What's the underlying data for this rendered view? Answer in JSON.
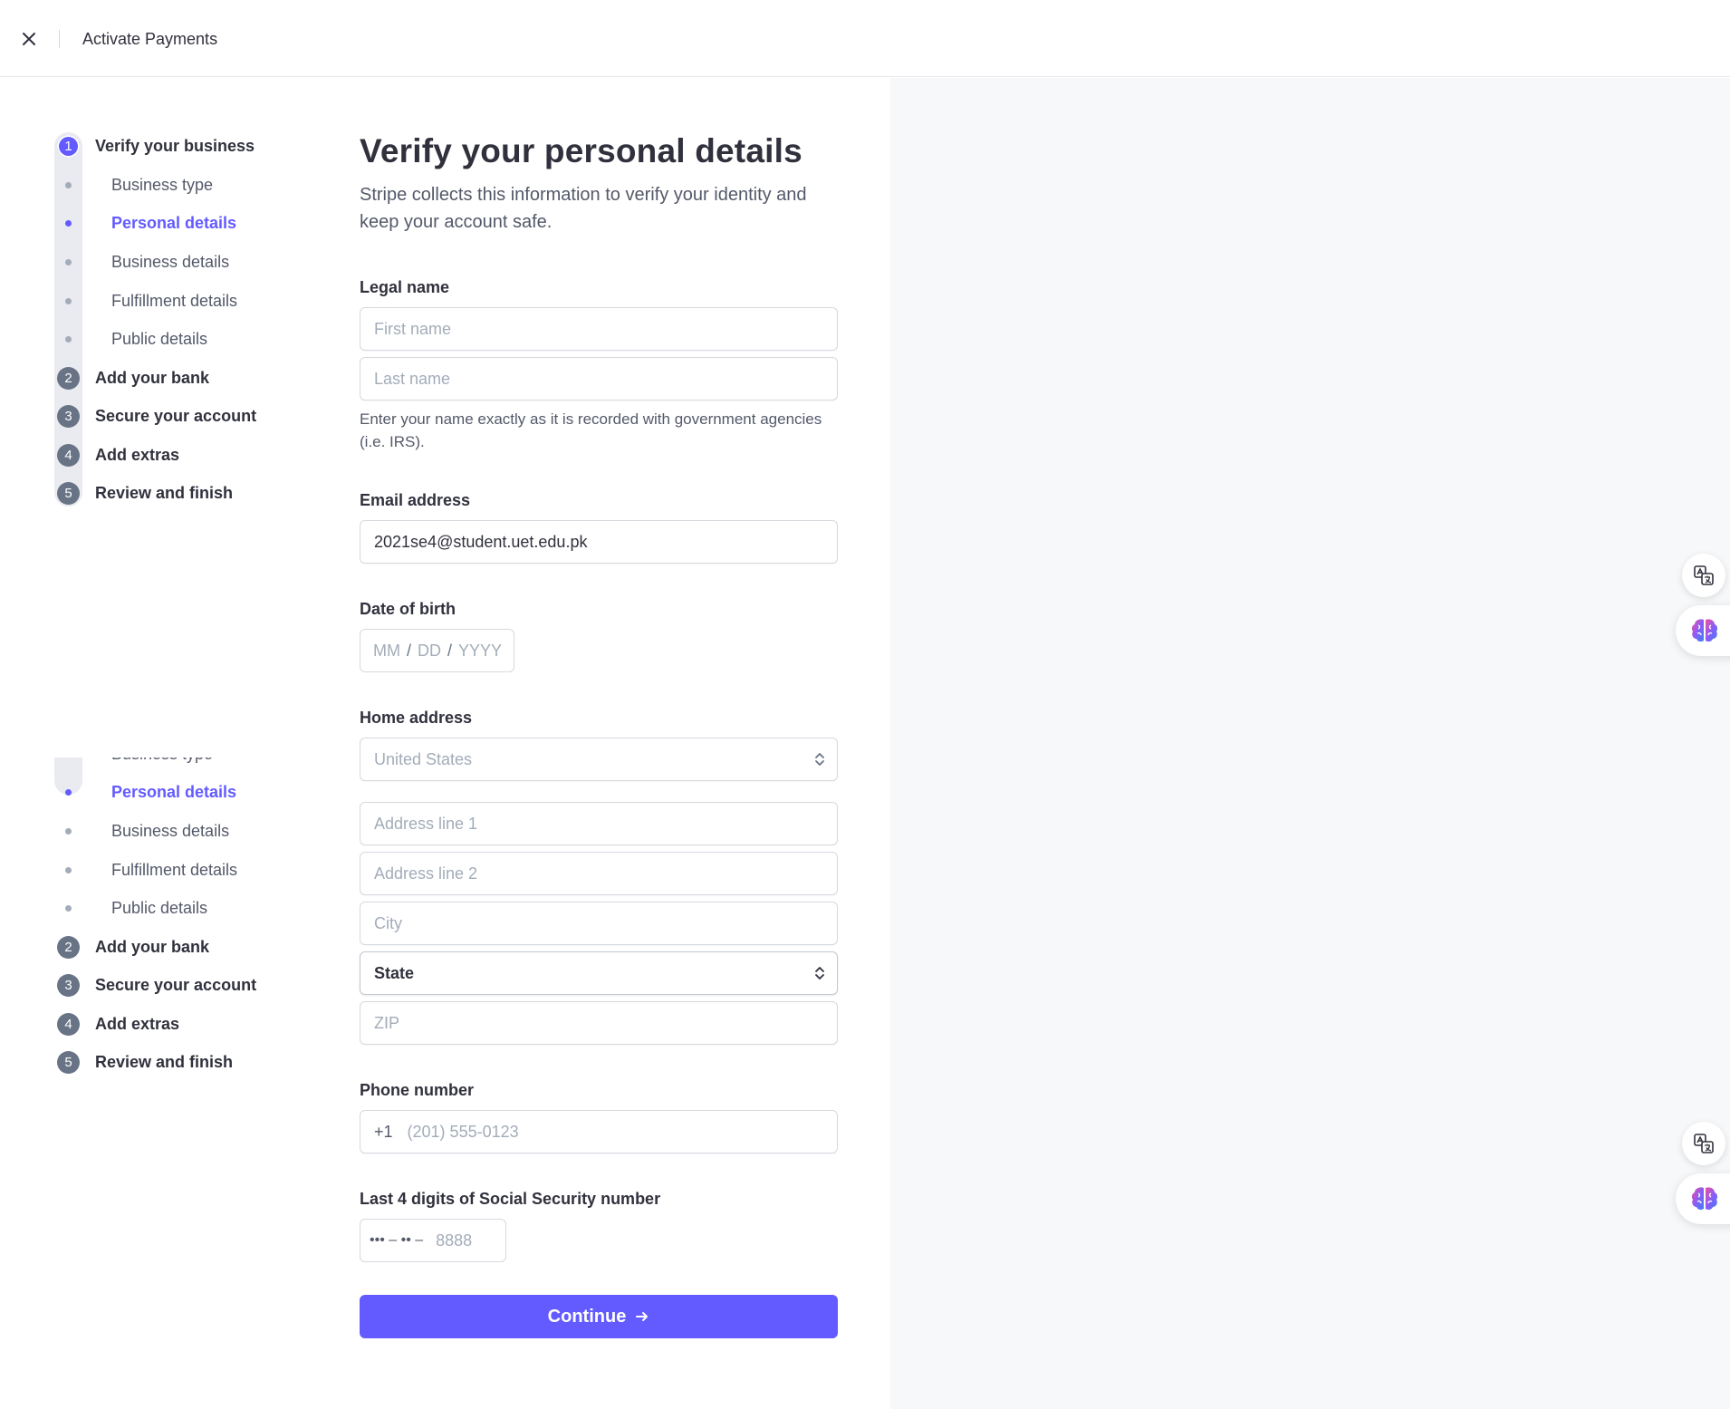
{
  "header": {
    "title": "Activate Payments"
  },
  "stepper": {
    "step1_number": "1",
    "step1_label": "Verify your business",
    "substeps": [
      "Business type",
      "Personal details",
      "Business details",
      "Fulfillment details",
      "Public details"
    ],
    "steps": [
      {
        "number": "2",
        "label": "Add your bank"
      },
      {
        "number": "3",
        "label": "Secure your account"
      },
      {
        "number": "4",
        "label": "Add extras"
      },
      {
        "number": "5",
        "label": "Review and finish"
      }
    ],
    "active_substep": "Personal details"
  },
  "form": {
    "title": "Verify your personal details",
    "subtitle": "Stripe collects this information to verify your identity and keep your account safe.",
    "legal_name": {
      "label": "Legal name",
      "first_placeholder": "First name",
      "last_placeholder": "Last name",
      "help": "Enter your name exactly as it is recorded with government agencies (i.e. IRS)."
    },
    "email": {
      "label": "Email address",
      "value": "2021se4@student.uet.edu.pk"
    },
    "dob": {
      "label": "Date of birth",
      "mm": "MM",
      "dd": "DD",
      "yyyy": "YYYY",
      "separator": "/"
    },
    "address": {
      "label": "Home address",
      "country": "United States",
      "line1_placeholder": "Address line 1",
      "line2_placeholder": "Address line 2",
      "city_placeholder": "City",
      "state": "State",
      "zip_placeholder": "ZIP"
    },
    "phone": {
      "label": "Phone number",
      "prefix": "+1",
      "placeholder": "(201) 555-0123"
    },
    "ssn": {
      "label": "Last 4 digits of Social Security number",
      "mask": "••• – •• –",
      "placeholder": "8888"
    },
    "continue_label": "Continue"
  },
  "colors": {
    "accent": "#635bff",
    "panel_bg": "#f6f8fa",
    "step_grey": "#687385"
  },
  "icons": [
    "close-icon",
    "chevron-updown-icon",
    "arrow-right-icon",
    "translate-icon",
    "brain-icon"
  ]
}
